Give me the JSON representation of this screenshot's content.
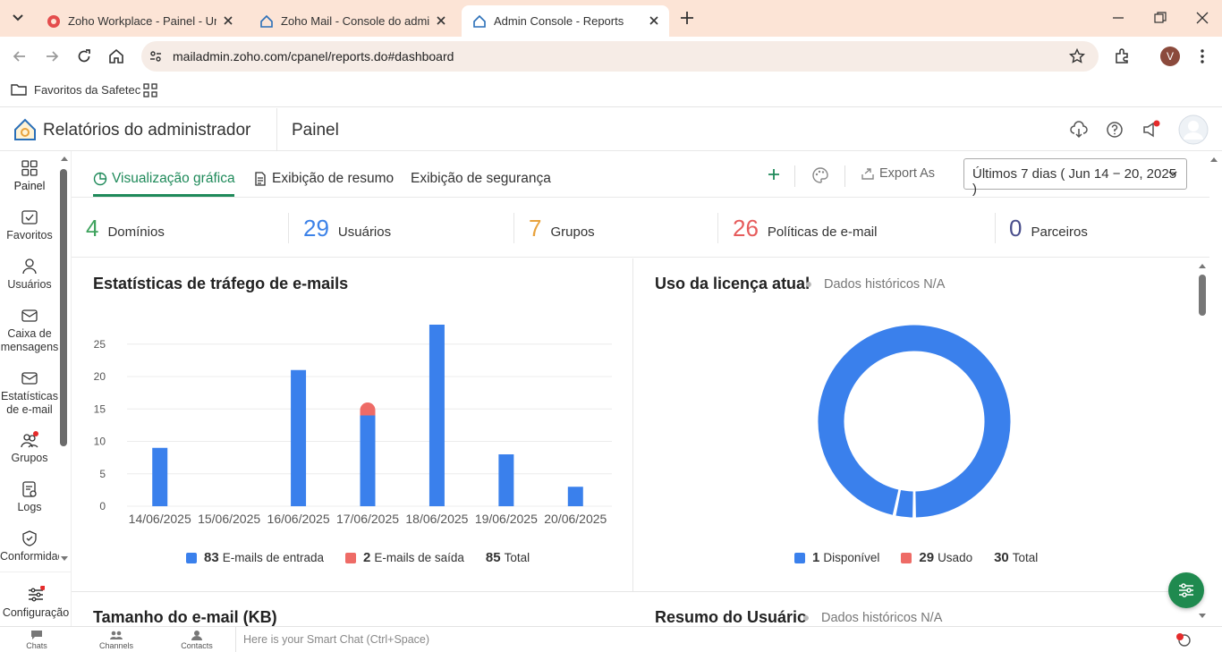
{
  "browser": {
    "tabs": [
      {
        "title": "Zoho Workplace - Painel - Uma",
        "active": false
      },
      {
        "title": "Zoho Mail - Console do admin",
        "active": false
      },
      {
        "title": "Admin Console - Reports",
        "active": true
      }
    ],
    "url": "mailadmin.zoho.com/cpanel/reports.do#dashboard",
    "bookmark_folder": "Favoritos da Safetec",
    "profile_initial": "V"
  },
  "header": {
    "app_title": "Relatórios do administrador",
    "page_title": "Painel"
  },
  "sidebar": {
    "items": [
      {
        "label": "Painel",
        "icon": "grid-icon"
      },
      {
        "label": "Favoritos",
        "icon": "favorites-icon"
      },
      {
        "label": "Usuários",
        "icon": "user-icon"
      },
      {
        "label": "Caixa de mensagens",
        "icon": "mailbox-icon"
      },
      {
        "label": "Estatísticas de e-mail",
        "icon": "mail-stats-icon"
      },
      {
        "label": "Grupos",
        "icon": "groups-icon"
      },
      {
        "label": "Logs",
        "icon": "logs-icon"
      },
      {
        "label": "Conformidade",
        "icon": "compliance-icon"
      }
    ],
    "settings_label": "Configuração"
  },
  "view_tabs": {
    "graphic": "Visualização gráfica",
    "summary": "Exibição de resumo",
    "security": "Exibição de segurança"
  },
  "toolbar": {
    "export_label": "Export As",
    "date_range": "Últimos 7 dias ( Jun 14 − 20, 2025 )"
  },
  "stats": [
    {
      "value": "4",
      "label": "Domínios",
      "color": "#3fa35e"
    },
    {
      "value": "29",
      "label": "Usuários",
      "color": "#3c82e8"
    },
    {
      "value": "7",
      "label": "Grupos",
      "color": "#e8a23c"
    },
    {
      "value": "26",
      "label": "Políticas de e-mail",
      "color": "#e65c5c"
    },
    {
      "value": "0",
      "label": "Parceiros",
      "color": "#4a4f8c"
    }
  ],
  "traffic_card": {
    "title": "Estatísticas de tráfego de e-mails",
    "legend": {
      "in_count": "83",
      "in_label": "E-mails de entrada",
      "out_count": "2",
      "out_label": "E-mails de saída",
      "total_count": "85",
      "total_label": "Total"
    }
  },
  "license_card": {
    "title": "Uso da licença atual",
    "subtitle": "Dados históricos N/A",
    "legend": {
      "available_count": "1",
      "available_label": "Disponível",
      "used_count": "29",
      "used_label": "Usado",
      "total_count": "30",
      "total_label": "Total"
    }
  },
  "size_card": {
    "title": "Tamanho do e-mail (KB)"
  },
  "user_summary_card": {
    "title": "Resumo do Usuário",
    "subtitle": "Dados históricos N/A"
  },
  "bottom_bar": {
    "chats": "Chats",
    "channels": "Channels",
    "contacts": "Contacts",
    "smart_chat_placeholder": "Here is your Smart Chat (Ctrl+Space)"
  },
  "colors": {
    "accent_green": "#1f8a5a",
    "bar_blue": "#3a80ec",
    "bar_red": "#ee6b66"
  },
  "chart_data": [
    {
      "type": "bar",
      "stacked": true,
      "categories": [
        "14/06/2025",
        "15/06/2025",
        "16/06/2025",
        "17/06/2025",
        "18/06/2025",
        "19/06/2025",
        "20/06/2025"
      ],
      "series": [
        {
          "name": "E-mails de entrada",
          "values": [
            9,
            0,
            21,
            14,
            28,
            8,
            3
          ],
          "color": "#3a80ec"
        },
        {
          "name": "E-mails de saída",
          "values": [
            0,
            0,
            0,
            2,
            0,
            0,
            0
          ],
          "color": "#ee6b66"
        }
      ],
      "yticks": [
        0,
        5,
        10,
        15,
        20,
        25
      ],
      "ylim": [
        0,
        28
      ],
      "grid": true
    },
    {
      "type": "pie",
      "donut": true,
      "labels": [
        "Disponível",
        "Usado"
      ],
      "values": [
        1,
        29
      ],
      "colors": [
        "#3a80ec",
        "#ee6b66"
      ]
    }
  ]
}
